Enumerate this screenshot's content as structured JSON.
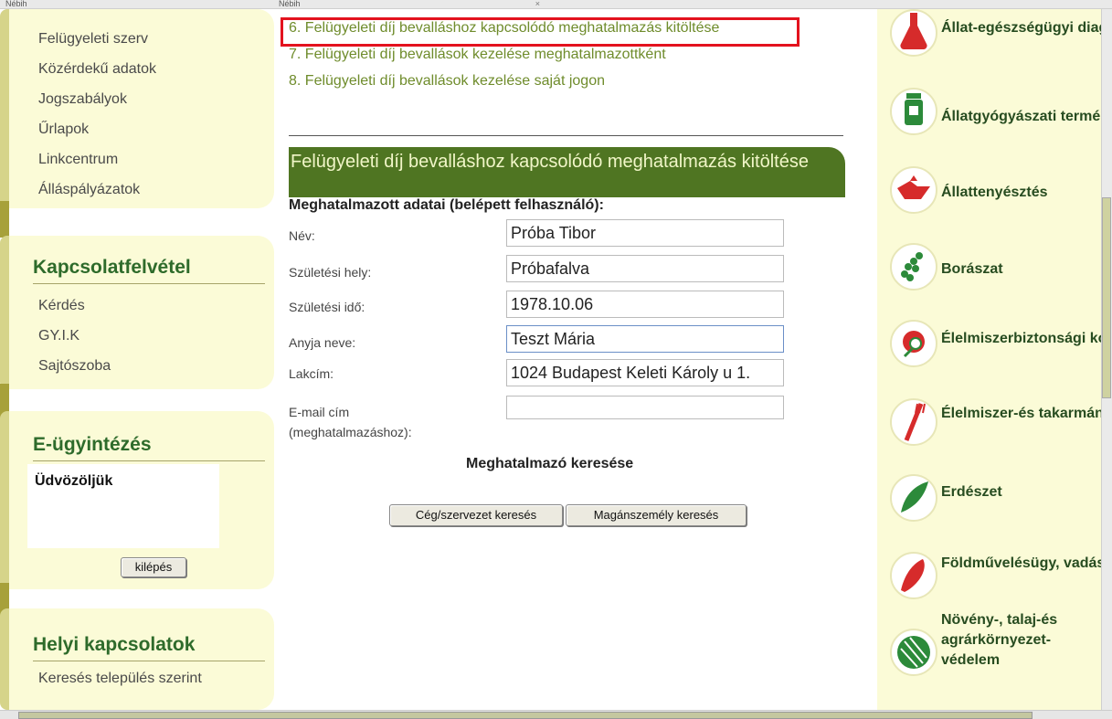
{
  "tabs": [
    {
      "label": "Nébih"
    },
    {
      "label": "Nébih",
      "close": "×"
    }
  ],
  "left_nav": {
    "links_top": [
      "Felügyeleti szerv",
      "Közérdekű adatok",
      "Jogszabályok",
      "Űrlapok",
      "Linkcentrum",
      "Álláspályázatok"
    ],
    "contact": {
      "title": "Kapcsolatfelvétel",
      "links": [
        "Kérdés",
        "GY.I.K",
        "Sajtószoba"
      ]
    },
    "eservices": {
      "title": "E-ügyintézés",
      "welcome": "Üdvözöljük",
      "logout": "kilépés"
    },
    "local": {
      "title": "Helyi kapcsolatok",
      "links": [
        "Keresés település szerint"
      ]
    }
  },
  "steps": [
    "6. Felügyeleti díj bevalláshoz kapcsolódó meghatalmazás kitöltése",
    "7. Felügyeleti díj bevallások kezelése meghatalmazottként",
    "8. Felügyeleti díj bevallások kezelése saját jogon"
  ],
  "form": {
    "title": "Felügyeleti díj bevalláshoz kapcsolódó meghatalmazás kitöltése",
    "section": "Meghatalmazott adatai (belépett felhasználó):",
    "fields": [
      {
        "label": "Név:",
        "value": "Próba Tibor"
      },
      {
        "label": "Születési hely:",
        "value": "Próbafalva"
      },
      {
        "label": "Születési idő:",
        "value": "1978.10.06"
      },
      {
        "label": "Anyja neve:",
        "value": "Teszt Mária"
      },
      {
        "label": "Lakcím:",
        "value": "1024 Budapest Keleti Károly u 1."
      },
      {
        "label": "E-mail cím (meghatalmazáshoz):",
        "value": ""
      }
    ],
    "search_title": "Meghatalmazó keresése",
    "btn_company": "Cég/szervezet keresés",
    "btn_person": "Magánszemély keresés"
  },
  "topics": [
    {
      "label": "Állat-egészségügyi diagnosztika",
      "icon": "flask-icon",
      "color": "#d62b2b"
    },
    {
      "label": "Állatgyógyászati termékek",
      "icon": "medicine-jar-icon",
      "color": "#2c8a3a"
    },
    {
      "label": "Állattenyésztés",
      "icon": "rooster-icon",
      "color": "#d62b2b"
    },
    {
      "label": "Borászat",
      "icon": "grapes-icon",
      "color": "#2c8a3a"
    },
    {
      "label": "Élelmiszerbiztonsági kockázatértékelés",
      "icon": "apple-magnifier-icon",
      "color": "#d62b2b"
    },
    {
      "label": "Élelmiszer-és takarmánybiztonság",
      "icon": "fork-icon",
      "color": "#d62b2b"
    },
    {
      "label": "Erdészet",
      "icon": "leaf-icon",
      "color": "#2c8a3a"
    },
    {
      "label": "Földművelésügy, vadászat, halászat",
      "icon": "fish-icon",
      "color": "#d62b2b"
    },
    {
      "label": "Növény-, talaj-és agrárkörnyezet-védelem",
      "icon": "striped-ball-icon",
      "color": "#2c8a3a"
    }
  ]
}
